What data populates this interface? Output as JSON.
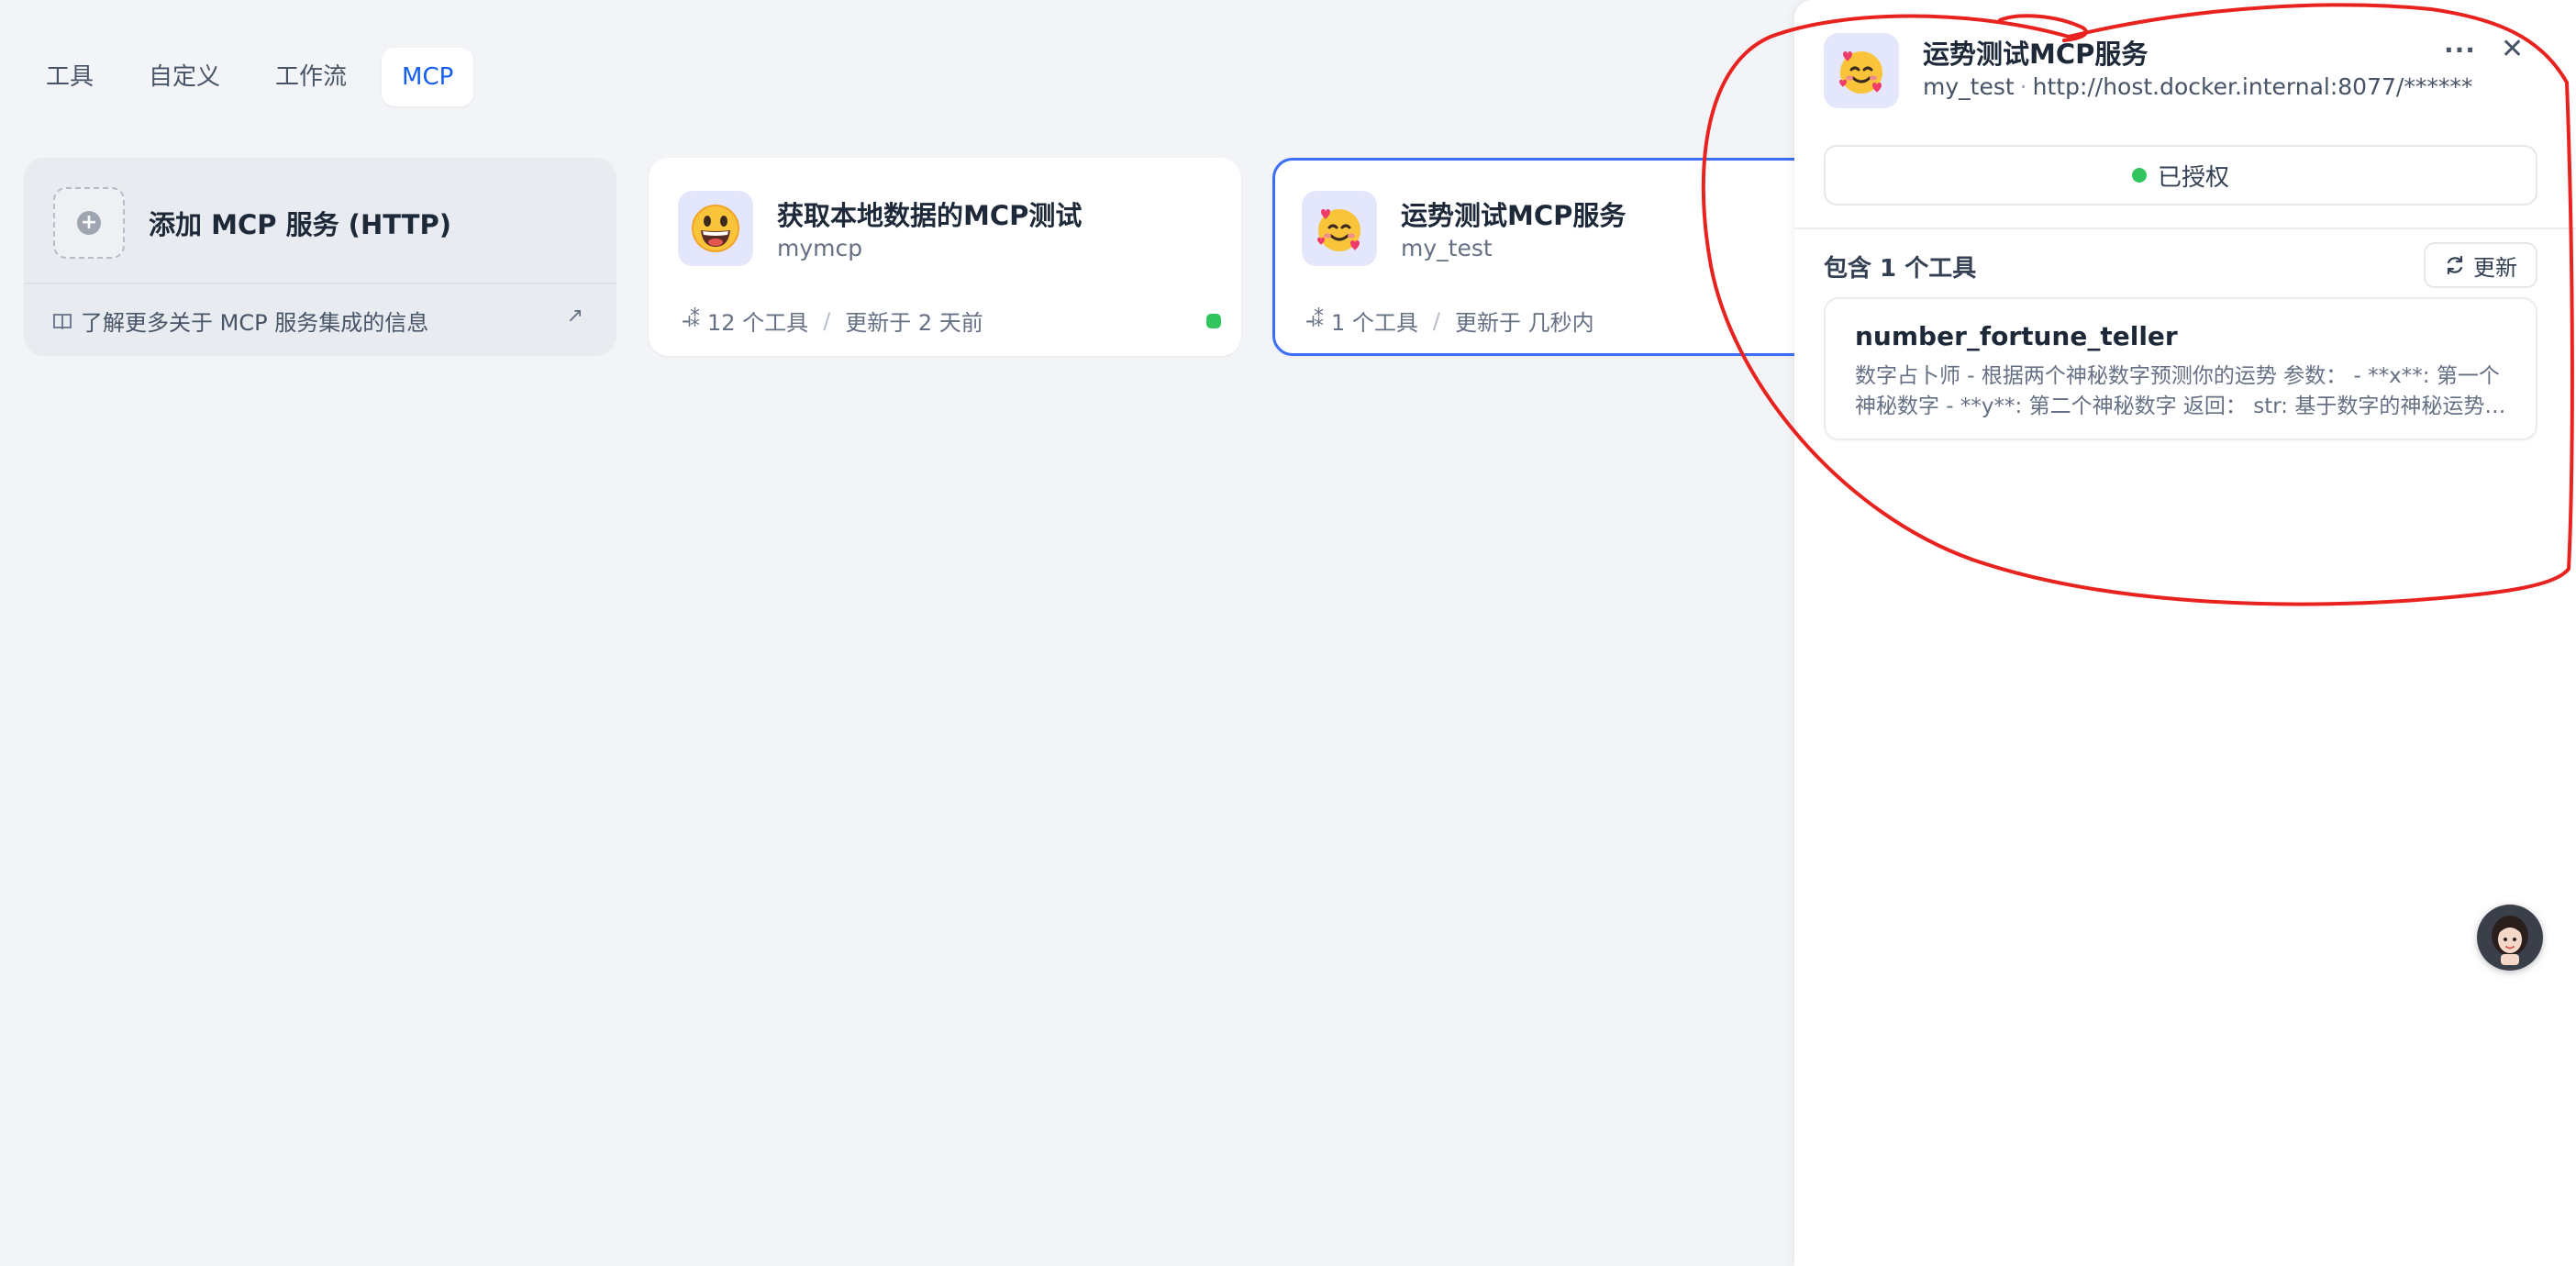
{
  "tabs": [
    {
      "label": "工具"
    },
    {
      "label": "自定义"
    },
    {
      "label": "工作流"
    },
    {
      "label": "MCP"
    }
  ],
  "active_tab": "MCP",
  "add_card": {
    "title": "添加 MCP 服务 (HTTP)",
    "link": "了解更多关于 MCP 服务集成的信息"
  },
  "services": [
    {
      "name": "获取本地数据的MCP测试",
      "id": "mymcp",
      "tools": "12 个工具",
      "updated": "更新于 2 天前",
      "status": "authorized"
    },
    {
      "name": "运势测试MCP服务",
      "id": "my_test",
      "tools": "1 个工具",
      "updated": "更新于 几秒内",
      "selected": true
    }
  ],
  "panel": {
    "title": "运势测试MCP服务",
    "id": "my_test",
    "url": "http://host.docker.internal:8077/******",
    "auth_label": "已授权",
    "tools_heading": "包含 1 个工具",
    "refresh_label": "更新",
    "tools": [
      {
        "name": "number_fortune_teller",
        "description": "数字占卜师 - 根据两个神秘数字预测你的运势 参数： - **x**: 第一个神秘数字 - **y**: 第二个神秘数字 返回： str: 基于数字的神秘运势预测"
      }
    ]
  },
  "colors": {
    "accent": "#155eef",
    "selected_border": "#3b6ef5",
    "status_green": "#32c45e",
    "annotation_red": "#e8231f"
  }
}
